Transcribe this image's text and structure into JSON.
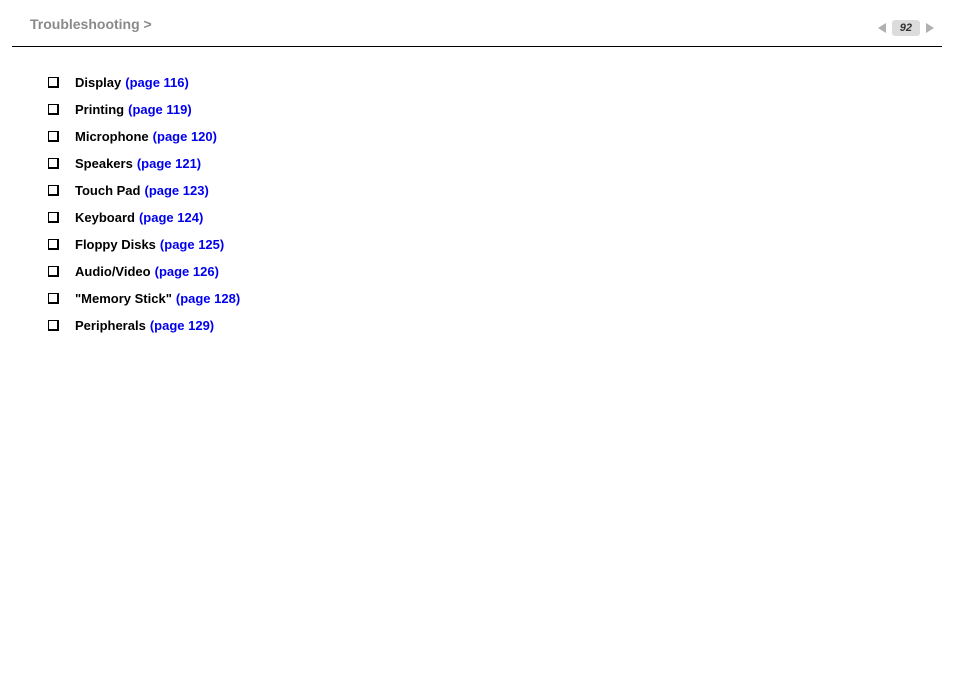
{
  "header": {
    "breadcrumb": "Troubleshooting >",
    "page_number": "92"
  },
  "items": [
    {
      "label": "Display",
      "page_ref": "(page 116)"
    },
    {
      "label": "Printing",
      "page_ref": "(page 119)"
    },
    {
      "label": "Microphone",
      "page_ref": "(page 120)"
    },
    {
      "label": "Speakers",
      "page_ref": "(page 121)"
    },
    {
      "label": "Touch Pad",
      "page_ref": "(page 123)"
    },
    {
      "label": "Keyboard",
      "page_ref": "(page 124)"
    },
    {
      "label": "Floppy Disks",
      "page_ref": "(page 125)"
    },
    {
      "label": "Audio/Video",
      "page_ref": "(page 126)"
    },
    {
      "label": "\"Memory Stick\"",
      "page_ref": "(page 128)"
    },
    {
      "label": "Peripherals",
      "page_ref": "(page 129)"
    }
  ]
}
